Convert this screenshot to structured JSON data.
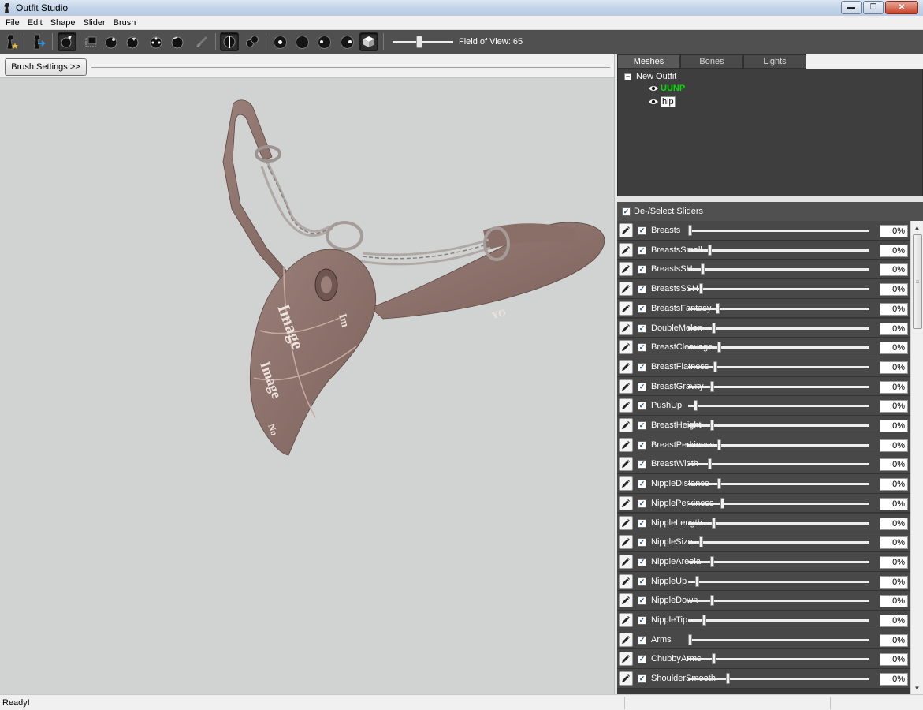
{
  "window": {
    "title": "Outfit Studio"
  },
  "menu": [
    "File",
    "Edit",
    "Shape",
    "Slider",
    "Brush"
  ],
  "toolbar": {
    "fov_label": "Field of View: 65",
    "fov_value": 65
  },
  "brush_settings_label": "Brush Settings >>",
  "tabs": [
    "Meshes",
    "Bones",
    "Lights"
  ],
  "mesh_tree": {
    "root": "New Outfit",
    "items": [
      {
        "label": "UUNP",
        "color": "#00e000"
      },
      {
        "label": "hip"
      }
    ]
  },
  "sliders_header": "De-/Select Sliders",
  "sliders": [
    {
      "name": "Breasts",
      "value": "0%",
      "pos": 0.0
    },
    {
      "name": "BreastsSmall",
      "value": "0%",
      "pos": 0.11
    },
    {
      "name": "BreastsSH",
      "value": "0%",
      "pos": 0.07
    },
    {
      "name": "BreastsSSH",
      "value": "0%",
      "pos": 0.06
    },
    {
      "name": "BreastsFantasy",
      "value": "0%",
      "pos": 0.15
    },
    {
      "name": "DoubleMelon",
      "value": "0%",
      "pos": 0.13
    },
    {
      "name": "BreastCleavage",
      "value": "0%",
      "pos": 0.16
    },
    {
      "name": "BreastFlatness",
      "value": "0%",
      "pos": 0.14
    },
    {
      "name": "BreastGravity",
      "value": "0%",
      "pos": 0.12
    },
    {
      "name": "PushUp",
      "value": "0%",
      "pos": 0.03
    },
    {
      "name": "BreastHeight",
      "value": "0%",
      "pos": 0.12
    },
    {
      "name": "BreastPerkiness",
      "value": "0%",
      "pos": 0.16
    },
    {
      "name": "BreastWidth",
      "value": "0%",
      "pos": 0.11
    },
    {
      "name": "NippleDistance",
      "value": "0%",
      "pos": 0.16
    },
    {
      "name": "NipplePerkiness",
      "value": "0%",
      "pos": 0.18
    },
    {
      "name": "NippleLength",
      "value": "0%",
      "pos": 0.13
    },
    {
      "name": "NippleSize",
      "value": "0%",
      "pos": 0.06
    },
    {
      "name": "NippleAreola",
      "value": "0%",
      "pos": 0.12
    },
    {
      "name": "NippleUp",
      "value": "0%",
      "pos": 0.04
    },
    {
      "name": "NippleDown",
      "value": "0%",
      "pos": 0.12
    },
    {
      "name": "NippleTip",
      "value": "0%",
      "pos": 0.08
    },
    {
      "name": "Arms",
      "value": "0%",
      "pos": 0.0
    },
    {
      "name": "ChubbyArms",
      "value": "0%",
      "pos": 0.13
    },
    {
      "name": "ShoulderSmooth",
      "value": "0%",
      "pos": 0.21
    }
  ],
  "status": {
    "text": "Ready!"
  },
  "colors": {
    "toolbar_bg": "#505050",
    "viewport_bg": "#d1d3d2",
    "panel_bg": "#3e3e3e",
    "mesh_active": "#00e000"
  }
}
